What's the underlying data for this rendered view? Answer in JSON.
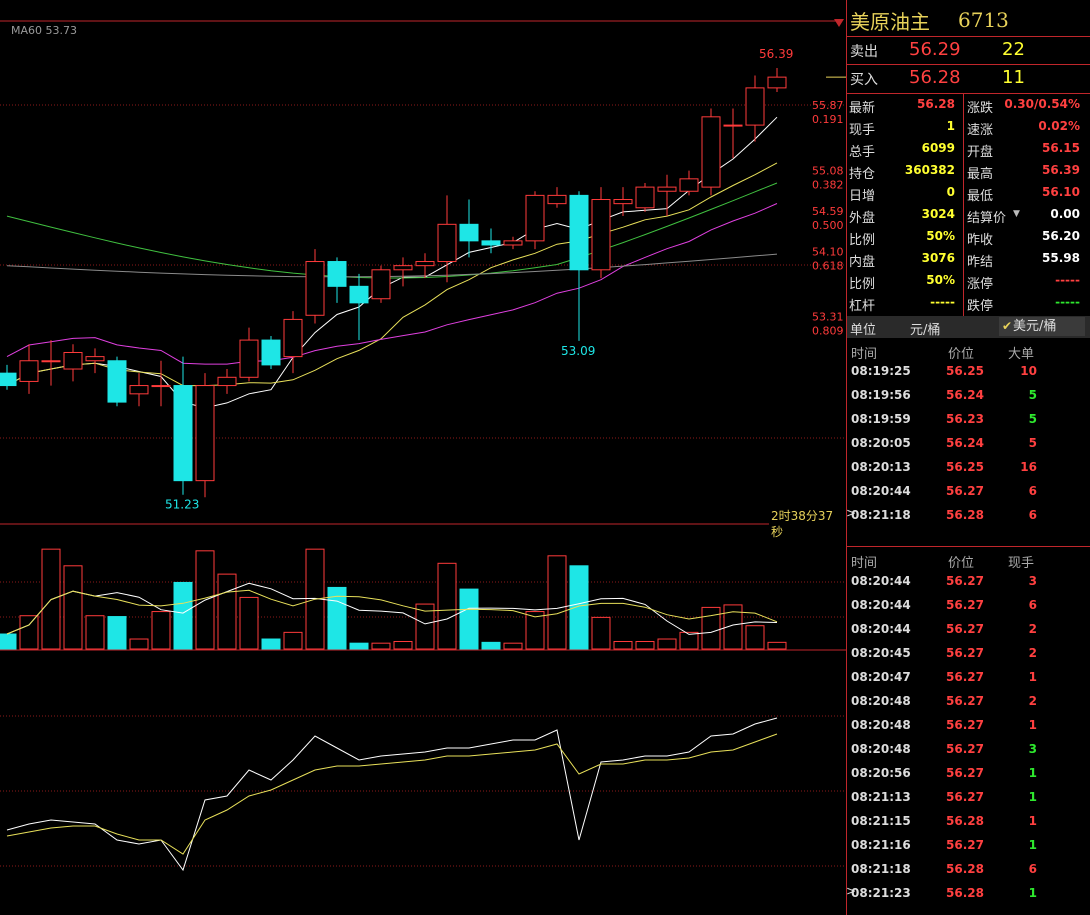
{
  "symbol": {
    "name": "美原油主",
    "code": "6713"
  },
  "ma_label": "MA60 53.73",
  "countdown": "2时38分37秒",
  "quote": {
    "sell": {
      "label": "卖出",
      "price": "56.29",
      "volume": "22"
    },
    "buy": {
      "label": "买入",
      "price": "56.28",
      "volume": "11"
    }
  },
  "grid": [
    {
      "l": "最新",
      "v": "56.28",
      "vc": "red",
      "l2": "涨跌",
      "v2": "0.30/0.54%",
      "v2c": "red"
    },
    {
      "l": "现手",
      "v": "1",
      "vc": "yellow",
      "l2": "速涨",
      "v2": "0.02%",
      "v2c": "red"
    },
    {
      "l": "总手",
      "v": "6099",
      "vc": "yellow",
      "l2": "开盘",
      "v2": "56.15",
      "v2c": "red"
    },
    {
      "l": "持仓",
      "v": "360382",
      "vc": "yellow",
      "l2": "最高",
      "v2": "56.39",
      "v2c": "red"
    },
    {
      "l": "日增",
      "v": "0",
      "vc": "yellow",
      "l2": "最低",
      "v2": "56.10",
      "v2c": "red"
    },
    {
      "l": "外盘",
      "v": "3024",
      "vc": "yellow",
      "l2": "结算价",
      "v2": "0.00",
      "v2c": "white",
      "dropdown": true
    },
    {
      "l": "比例",
      "v": "50%",
      "vc": "yellow",
      "l2": "昨收",
      "v2": "56.20",
      "v2c": "white"
    },
    {
      "l": "内盘",
      "v": "3076",
      "vc": "yellow",
      "l2": "昨结",
      "v2": "55.98",
      "v2c": "white"
    },
    {
      "l": "比例",
      "v": "50%",
      "vc": "yellow",
      "l2": "涨停",
      "v2": "-----",
      "v2c": "red"
    },
    {
      "l": "杠杆",
      "v": "-----",
      "vc": "yellow",
      "l2": "跌停",
      "v2": "-----",
      "v2c": "green"
    }
  ],
  "unit": {
    "label": "单位",
    "option_a": "元/桶",
    "option_b": "美元/桶",
    "selected": "美元/桶"
  },
  "big_orders": {
    "headers": {
      "time": "时间",
      "price": "价位",
      "vol": "大单"
    },
    "rows": [
      {
        "time": "08:19:25",
        "price": "56.25",
        "vol": "10",
        "c": "red"
      },
      {
        "time": "08:19:56",
        "price": "56.24",
        "vol": "5",
        "c": "green"
      },
      {
        "time": "08:19:59",
        "price": "56.23",
        "vol": "5",
        "c": "green"
      },
      {
        "time": "08:20:05",
        "price": "56.24",
        "vol": "5",
        "c": "red"
      },
      {
        "time": "08:20:13",
        "price": "56.25",
        "vol": "16",
        "c": "red"
      },
      {
        "time": "08:20:44",
        "price": "56.27",
        "vol": "6",
        "c": "red"
      },
      {
        "time": "08:21:18",
        "price": "56.28",
        "vol": "6",
        "c": "red",
        "marker": true
      }
    ]
  },
  "ticks": {
    "headers": {
      "time": "时间",
      "price": "价位",
      "vol": "现手"
    },
    "rows": [
      {
        "time": "08:20:44",
        "price": "56.27",
        "vol": "3",
        "c": "red"
      },
      {
        "time": "08:20:44",
        "price": "56.27",
        "vol": "6",
        "c": "red"
      },
      {
        "time": "08:20:44",
        "price": "56.27",
        "vol": "2",
        "c": "red"
      },
      {
        "time": "08:20:45",
        "price": "56.27",
        "vol": "2",
        "c": "red"
      },
      {
        "time": "08:20:47",
        "price": "56.27",
        "vol": "1",
        "c": "red"
      },
      {
        "time": "08:20:48",
        "price": "56.27",
        "vol": "2",
        "c": "red"
      },
      {
        "time": "08:20:48",
        "price": "56.27",
        "vol": "1",
        "c": "red"
      },
      {
        "time": "08:20:48",
        "price": "56.27",
        "vol": "3",
        "c": "green"
      },
      {
        "time": "08:20:56",
        "price": "56.27",
        "vol": "1",
        "c": "green"
      },
      {
        "time": "08:21:13",
        "price": "56.27",
        "vol": "1",
        "c": "green"
      },
      {
        "time": "08:21:15",
        "price": "56.28",
        "vol": "1",
        "c": "red"
      },
      {
        "time": "08:21:16",
        "price": "56.27",
        "vol": "1",
        "c": "green"
      },
      {
        "time": "08:21:18",
        "price": "56.28",
        "vol": "6",
        "c": "red"
      },
      {
        "time": "08:21:23",
        "price": "56.28",
        "vol": "1",
        "c": "green",
        "marker": true
      }
    ]
  },
  "colors": {
    "up": "#ff3b3b",
    "down": "#1ee6e6",
    "ma5": "#ffffff",
    "ma10": "#e8e05a",
    "ma20": "#e040e0",
    "ma40": "#40c040",
    "ma60": "#8a8a8a",
    "grid": "#8b1a1a"
  },
  "chart_data": {
    "type": "candlestick",
    "price_range": [
      50.9,
      56.85
    ],
    "fib_levels": [
      {
        "price": "55.87",
        "ratio": "0.191"
      },
      {
        "price": "55.08",
        "ratio": "0.382"
      },
      {
        "price": "54.59",
        "ratio": "0.500"
      },
      {
        "price": "54.10",
        "ratio": "0.618"
      },
      {
        "price": "53.31",
        "ratio": "0.809"
      }
    ],
    "annotations": [
      {
        "text": "56.39",
        "index": 35
      },
      {
        "text": "53.09",
        "index": 26
      },
      {
        "text": "51.23",
        "index": 8
      }
    ],
    "candles": [
      [
        52.7,
        52.55,
        52.8,
        52.5
      ],
      [
        52.6,
        52.85,
        53.05,
        52.45
      ],
      [
        52.85,
        52.85,
        53.1,
        52.55
      ],
      [
        52.75,
        52.95,
        53.05,
        52.6
      ],
      [
        52.85,
        52.9,
        53.0,
        52.7
      ],
      [
        52.85,
        52.35,
        52.9,
        52.3
      ],
      [
        52.45,
        52.55,
        52.7,
        52.3
      ],
      [
        52.55,
        52.55,
        52.85,
        52.3
      ],
      [
        52.55,
        51.4,
        52.9,
        51.23
      ],
      [
        51.4,
        52.55,
        52.7,
        51.2
      ],
      [
        52.55,
        52.65,
        52.75,
        52.45
      ],
      [
        52.65,
        53.1,
        53.25,
        52.6
      ],
      [
        53.1,
        52.8,
        53.15,
        52.75
      ],
      [
        52.9,
        53.35,
        53.45,
        52.7
      ],
      [
        53.4,
        54.05,
        54.2,
        53.3
      ],
      [
        54.05,
        53.75,
        54.1,
        53.55
      ],
      [
        53.75,
        53.55,
        53.9,
        53.1
      ],
      [
        53.6,
        53.95,
        54.0,
        53.55
      ],
      [
        53.95,
        54.0,
        54.1,
        53.75
      ],
      [
        54.0,
        54.05,
        54.15,
        53.85
      ],
      [
        54.05,
        54.5,
        54.85,
        53.8
      ],
      [
        54.5,
        54.3,
        54.8,
        54.1
      ],
      [
        54.3,
        54.25,
        54.45,
        54.15
      ],
      [
        54.25,
        54.3,
        54.35,
        54.2
      ],
      [
        54.3,
        54.85,
        54.9,
        54.2
      ],
      [
        54.75,
        54.85,
        54.95,
        54.7
      ],
      [
        54.85,
        53.95,
        54.9,
        53.09
      ],
      [
        53.95,
        54.8,
        54.95,
        53.85
      ],
      [
        54.75,
        54.8,
        54.95,
        54.6
      ],
      [
        54.7,
        54.95,
        55.0,
        54.65
      ],
      [
        54.9,
        54.95,
        55.1,
        54.6
      ],
      [
        54.9,
        55.05,
        55.15,
        54.85
      ],
      [
        54.95,
        55.8,
        55.9,
        54.85
      ],
      [
        55.7,
        55.7,
        55.9,
        55.3
      ],
      [
        55.7,
        56.15,
        56.3,
        55.5
      ],
      [
        56.15,
        56.28,
        56.39,
        56.1
      ]
    ],
    "volume": [
      18,
      40,
      120,
      100,
      40,
      39,
      12,
      45,
      80,
      118,
      90,
      62,
      12,
      20,
      120,
      74,
      7,
      7,
      9,
      54,
      103,
      72,
      8,
      7,
      45,
      112,
      100,
      38,
      9,
      9,
      12,
      20,
      50,
      53,
      28,
      8
    ],
    "indicator_a": [
      0.25,
      0.28,
      0.3,
      0.29,
      0.28,
      0.2,
      0.18,
      0.2,
      0.05,
      0.4,
      0.42,
      0.55,
      0.5,
      0.6,
      0.72,
      0.66,
      0.6,
      0.62,
      0.63,
      0.64,
      0.66,
      0.66,
      0.68,
      0.7,
      0.7,
      0.75,
      0.2,
      0.59,
      0.6,
      0.62,
      0.62,
      0.64,
      0.72,
      0.73,
      0.78,
      0.81
    ],
    "indicator_b": [
      0.22,
      0.24,
      0.26,
      0.27,
      0.27,
      0.23,
      0.2,
      0.2,
      0.13,
      0.3,
      0.35,
      0.42,
      0.45,
      0.5,
      0.55,
      0.57,
      0.57,
      0.58,
      0.59,
      0.6,
      0.62,
      0.62,
      0.63,
      0.64,
      0.65,
      0.68,
      0.53,
      0.58,
      0.58,
      0.6,
      0.6,
      0.61,
      0.64,
      0.65,
      0.69,
      0.73
    ]
  }
}
